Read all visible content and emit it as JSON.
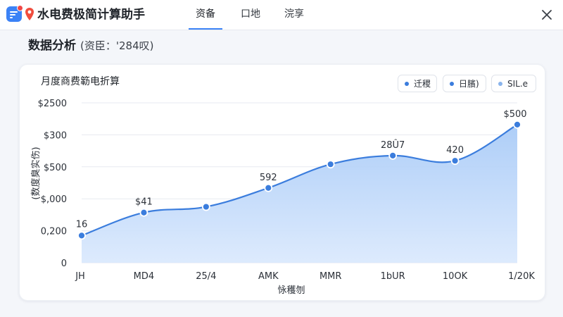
{
  "header": {
    "app_title": "水电费极简计算助手",
    "tabs": [
      {
        "label": "资备",
        "active": true
      },
      {
        "label": "口地",
        "active": false
      },
      {
        "label": "浣享",
        "active": false
      }
    ],
    "accent_color": "#3b82f6"
  },
  "section": {
    "title": "数据分析",
    "paren": "(资臣：'284叹)"
  },
  "legend": [
    {
      "label": "迁稷",
      "color": "#3b7ddd"
    },
    {
      "label": "日臏)",
      "color": "#3b7ddd"
    },
    {
      "label": "SIL.e",
      "color": "#8ab4ec"
    }
  ],
  "chart_data": {
    "type": "area",
    "title": "月度商费簕电折算",
    "xlabel": "怺穫刎",
    "ylabel": "(数度臭实伤)",
    "categories": [
      "JH",
      "MD4",
      "25/4",
      "AMK",
      "MMR",
      "1bUR",
      "10OK",
      "1/20K"
    ],
    "y_ticks": [
      "$2500",
      "$300",
      "$500",
      "$,000",
      "0,200",
      "0"
    ],
    "y_positions": [
      5,
      4,
      3,
      2,
      1,
      0
    ],
    "values": [
      0.85,
      1.57,
      1.75,
      2.34,
      3.08,
      3.35,
      3.19,
      4.32
    ],
    "data_labels": [
      {
        "index": 0,
        "text": "16"
      },
      {
        "index": 1,
        "text": "$41"
      },
      {
        "index": 3,
        "text": "592"
      },
      {
        "index": 5,
        "text": "28Û7"
      },
      {
        "index": 6,
        "text": "420"
      },
      {
        "index": 7,
        "text": "$500"
      }
    ],
    "ylim": [
      0,
      5
    ],
    "grid": "horizontal",
    "line_color": "#3b7ddd",
    "fill_color": "#bcd6fa",
    "legend_position": "top-right"
  }
}
